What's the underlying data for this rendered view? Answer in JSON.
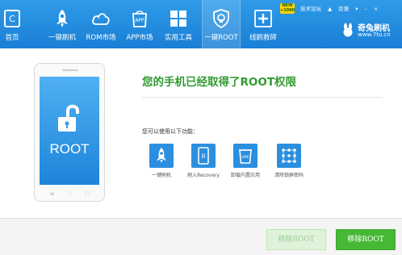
{
  "nav": {
    "home": "首页",
    "onekey_flash": "一键刷机",
    "rom_market": "ROM市场",
    "app_market": "APP市场",
    "tools": "实用工具",
    "onekey_root": "一键ROOT",
    "line_flash": "线刷救砖"
  },
  "topbar_extra": {
    "new_badge": "NEW +1000",
    "forum": "技术论坛",
    "feedback": "反馈",
    "minimize": "–",
    "close": "×"
  },
  "brand": {
    "name": "奇兔刷机",
    "url": "www.7to.cn"
  },
  "phone": {
    "screen_text": "ROOT"
  },
  "main": {
    "headline": "您的手机已经取得了ROOT权限",
    "subhead": "您可以使用以下功能：",
    "functions": [
      {
        "label": "一键刷机",
        "icon": "rocket-icon"
      },
      {
        "label": "刷入Recovery",
        "icon": "recovery-icon"
      },
      {
        "label": "卸载内置应用",
        "icon": "apk-trash-icon"
      },
      {
        "label": "清除锁屏密码",
        "icon": "pattern-lock-icon"
      }
    ]
  },
  "buttons": {
    "remove_root": "移除ROOT",
    "remove_root_primary": "移除ROOT"
  },
  "colors": {
    "topbar": "#1a7fd6",
    "accent_green": "#47b835",
    "headline_green": "#2f9a2f"
  }
}
